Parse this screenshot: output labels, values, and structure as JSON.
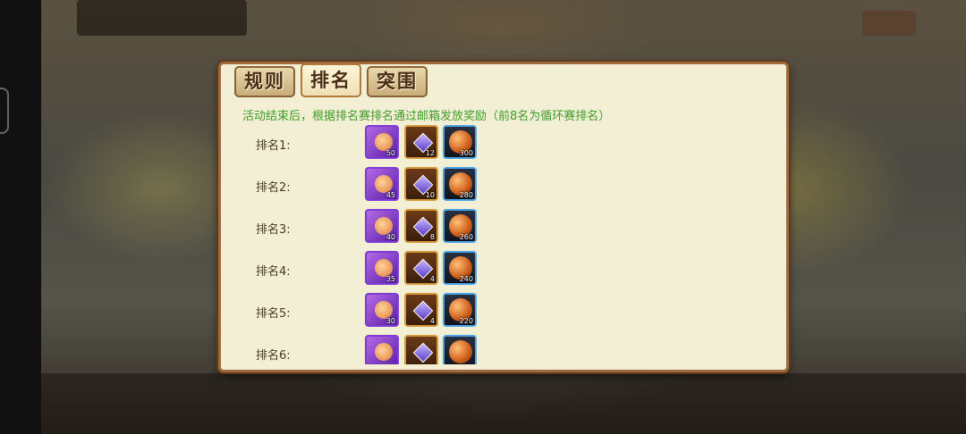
{
  "tabs": [
    {
      "label": "规则",
      "active": false
    },
    {
      "label": "排名",
      "active": true
    },
    {
      "label": "突围",
      "active": false
    }
  ],
  "notice": "活动结束后，根据排名赛排名通过邮箱发放奖励（前8名为循环赛排名）",
  "rewards": [
    {
      "rank_label": "排名1:",
      "hero": "50",
      "chest": "12",
      "orb": "300"
    },
    {
      "rank_label": "排名2:",
      "hero": "45",
      "chest": "10",
      "orb": "280"
    },
    {
      "rank_label": "排名3:",
      "hero": "40",
      "chest": "8",
      "orb": "260"
    },
    {
      "rank_label": "排名4:",
      "hero": "35",
      "chest": "4",
      "orb": "240"
    },
    {
      "rank_label": "排名5:",
      "hero": "30",
      "chest": "4",
      "orb": "220"
    },
    {
      "rank_label": "排名6:",
      "hero": "",
      "chest": "",
      "orb": ""
    }
  ],
  "item_icons": [
    "hero-fragment-icon",
    "treasure-chest-icon",
    "fire-orb-icon"
  ]
}
